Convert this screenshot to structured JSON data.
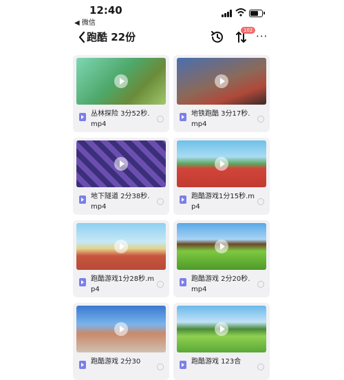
{
  "status_bar": {
    "time": "12:40",
    "back_app": "◀ 微信"
  },
  "nav": {
    "title": "跑酷 22份",
    "badge": "102",
    "more": "···"
  },
  "videos": [
    {
      "name": "丛林探险 3分52秒.mp4"
    },
    {
      "name": "地铁跑酷 3分17秒.mp4"
    },
    {
      "name": "地下隧道 2分38秒.mp4"
    },
    {
      "name": "跑酷游戏1分15秒.mp4"
    },
    {
      "name": "跑酷游戏1分28秒.mp4"
    },
    {
      "name": "跑酷游戏 2分20秒.mp4"
    },
    {
      "name": "跑酷游戏 2分30"
    },
    {
      "name": "跑酷游戏 123合"
    }
  ]
}
